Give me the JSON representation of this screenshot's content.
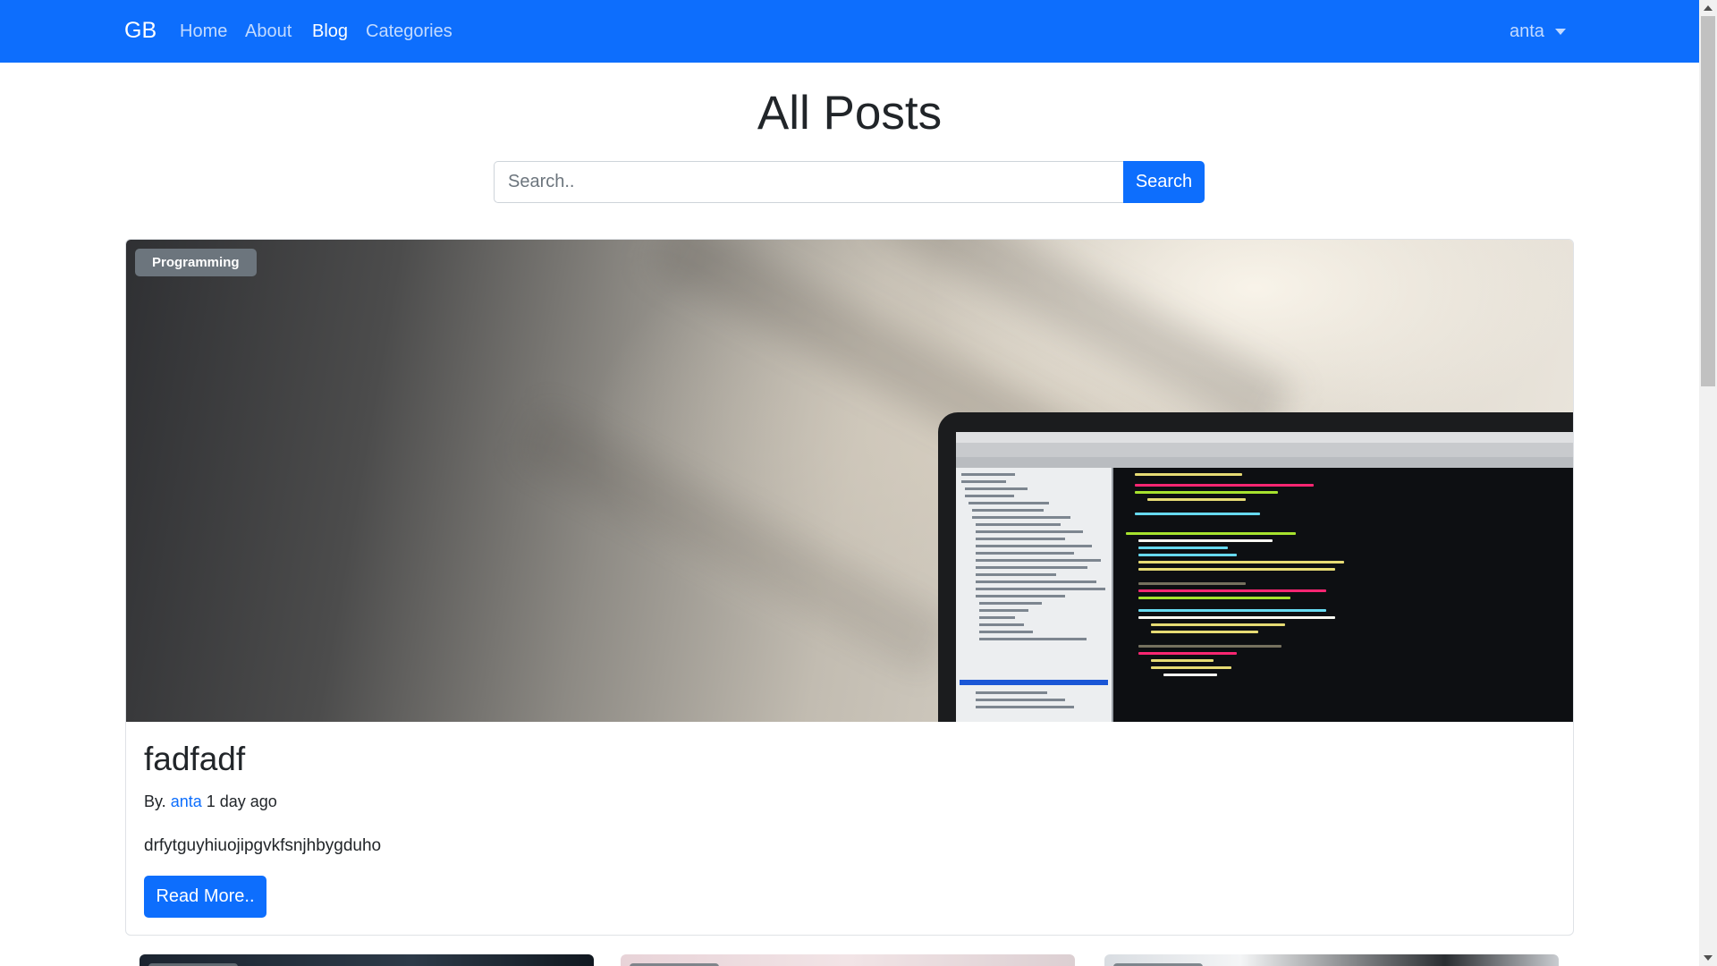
{
  "navbar": {
    "brand": "GB",
    "links": [
      {
        "label": "Home",
        "active": false
      },
      {
        "label": "About",
        "active": false
      },
      {
        "label": "Blog",
        "active": true
      },
      {
        "label": "Categories",
        "active": false
      }
    ],
    "user": {
      "name": "anta",
      "icon": "caret-down-icon"
    }
  },
  "main": {
    "title": "All Posts",
    "search": {
      "placeholder": "Search..",
      "value": "",
      "button_label": "Search"
    }
  },
  "featured_post": {
    "category": "Programming",
    "title": "fadfadf",
    "byline_prefix": "By.",
    "author": "anta",
    "time_ago": "1 day ago",
    "excerpt": "drfytguyhiuojipgvkfsnjhbygduho",
    "read_more_label": "Read More..",
    "image": "laptop-with-code-on-wall-background"
  },
  "more_posts": [
    {
      "image": "dark-blue-photo"
    },
    {
      "image": "pink-photo"
    },
    {
      "image": "desk-monitor-photo"
    }
  ],
  "colors": {
    "primary": "#0d6efd",
    "badge": "#6c757d",
    "text": "#212529",
    "border": "#dfe2e6"
  }
}
